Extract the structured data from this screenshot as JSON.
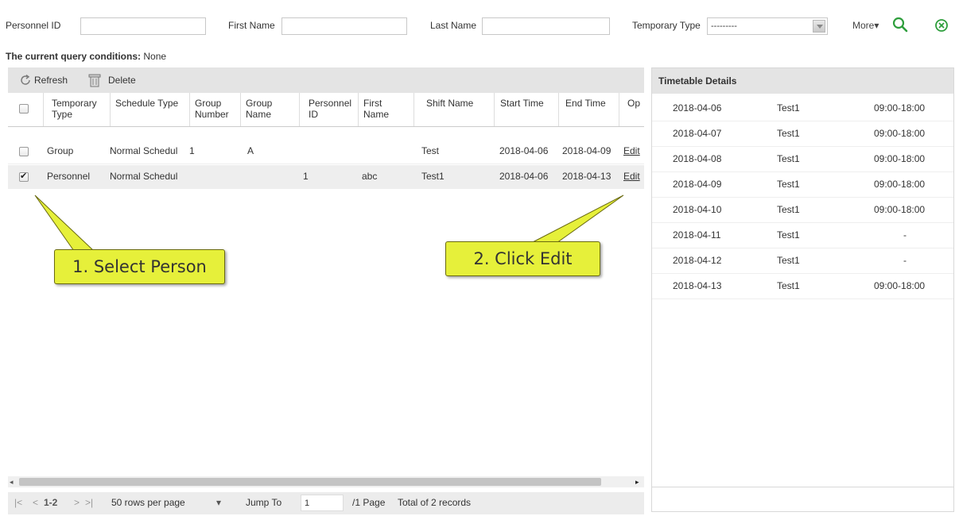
{
  "filters": {
    "personnel_id_label": "Personnel ID",
    "personnel_id_value": "",
    "first_name_label": "First Name",
    "first_name_value": "",
    "last_name_label": "Last Name",
    "last_name_value": "",
    "temporary_type_label": "Temporary Type",
    "temporary_type_value": "---------",
    "more_label": "More▾"
  },
  "query": {
    "label": "The current query conditions:",
    "value": "None"
  },
  "toolbar": {
    "refresh_label": "Refresh",
    "delete_label": "Delete"
  },
  "table": {
    "columns": [
      "Temporary Type",
      "Schedule Type",
      "Group Number",
      "Group Name",
      "Personnel ID",
      "First Name",
      "Shift Name",
      "Start Time",
      "End Time",
      "Op"
    ],
    "rows": [
      {
        "checked": false,
        "temporary_type": "Group",
        "schedule_type": "Normal Schedul",
        "group_number": "1",
        "group_name": "A",
        "personnel_id": "",
        "first_name": "",
        "shift_name": "Test",
        "start_time": "2018-04-06",
        "end_time": "2018-04-09",
        "op": "Edit"
      },
      {
        "checked": true,
        "temporary_type": "Personnel",
        "schedule_type": "Normal Schedul",
        "group_number": "",
        "group_name": "",
        "personnel_id": "1",
        "first_name": "abc",
        "shift_name": "Test1",
        "start_time": "2018-04-06",
        "end_time": "2018-04-13",
        "op": "Edit"
      }
    ]
  },
  "pager": {
    "range": "1-2",
    "rows_per_page": "50 rows per page",
    "jump_to_label": "Jump To",
    "jump_to_value": "1",
    "page_total": "/1 Page",
    "total_records": "Total of 2 records"
  },
  "timetable": {
    "title": "Timetable Details",
    "rows": [
      {
        "date": "2018-04-06",
        "name": "Test1",
        "time": "09:00-18:00"
      },
      {
        "date": "2018-04-07",
        "name": "Test1",
        "time": "09:00-18:00"
      },
      {
        "date": "2018-04-08",
        "name": "Test1",
        "time": "09:00-18:00"
      },
      {
        "date": "2018-04-09",
        "name": "Test1",
        "time": "09:00-18:00"
      },
      {
        "date": "2018-04-10",
        "name": "Test1",
        "time": "09:00-18:00"
      },
      {
        "date": "2018-04-11",
        "name": "Test1",
        "time": "-"
      },
      {
        "date": "2018-04-12",
        "name": "Test1",
        "time": "-"
      },
      {
        "date": "2018-04-13",
        "name": "Test1",
        "time": "09:00-18:00"
      }
    ]
  },
  "callouts": {
    "first": "1. Select Person",
    "second": "2. Click Edit"
  },
  "colors": {
    "callout": "#e6f03a",
    "toolbar_bg": "#e4e4e4",
    "search_icon": "#2e9e3c",
    "clear_icon": "#2e9e3c",
    "link": "#333333"
  }
}
